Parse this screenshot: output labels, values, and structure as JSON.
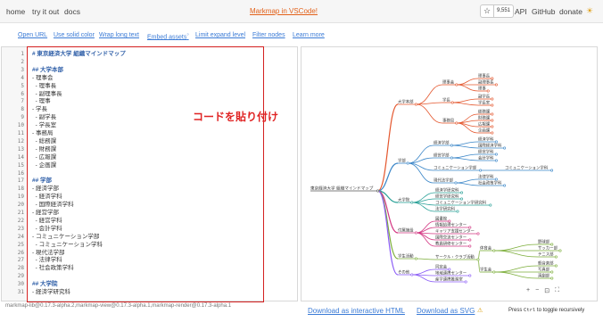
{
  "nav": {
    "home": "home",
    "try": "try it out",
    "docs": "docs",
    "vscode": "Markmap in VSCode!",
    "star_count": "9,551",
    "api": "API",
    "github": "GitHub",
    "donate": "donate"
  },
  "toolbar": {
    "open_url": "Open URL",
    "solid_color": "Use solid color",
    "wrap": "Wrap long text",
    "embed": "Embed assets",
    "embed_sup": "?",
    "limit": "Limit expand level",
    "filter": "Filter nodes",
    "learn": "Learn more"
  },
  "editor": {
    "lines": [
      {
        "n": "1",
        "t": "# 東京経済大学 組織マインドマップ",
        "k": "h"
      },
      {
        "n": "2",
        "t": "",
        "k": ""
      },
      {
        "n": "3",
        "t": "## 大学本部",
        "k": "h"
      },
      {
        "n": "4",
        "t": "- 理事会",
        "k": "li"
      },
      {
        "n": "5",
        "t": "  - 理事長",
        "k": "li"
      },
      {
        "n": "6",
        "t": "  - 副理事長",
        "k": "li"
      },
      {
        "n": "7",
        "t": "  - 理事",
        "k": "li"
      },
      {
        "n": "8",
        "t": "- 学長",
        "k": "li"
      },
      {
        "n": "9",
        "t": "  - 副学長",
        "k": "li"
      },
      {
        "n": "10",
        "t": "  - 学長室",
        "k": "li"
      },
      {
        "n": "11",
        "t": "- 事務局",
        "k": "li"
      },
      {
        "n": "12",
        "t": "  - 総務課",
        "k": "li"
      },
      {
        "n": "13",
        "t": "  - 財務課",
        "k": "li"
      },
      {
        "n": "14",
        "t": "  - 広報課",
        "k": "li"
      },
      {
        "n": "15",
        "t": "  - 企画課",
        "k": "li"
      },
      {
        "n": "16",
        "t": "",
        "k": ""
      },
      {
        "n": "17",
        "t": "## 学部",
        "k": "h"
      },
      {
        "n": "18",
        "t": "- 経済学部",
        "k": "li"
      },
      {
        "n": "19",
        "t": "  - 経済学科",
        "k": "li"
      },
      {
        "n": "20",
        "t": "  - 国際経済学科",
        "k": "li"
      },
      {
        "n": "21",
        "t": "- 経営学部",
        "k": "li"
      },
      {
        "n": "22",
        "t": "  - 経営学科",
        "k": "li"
      },
      {
        "n": "23",
        "t": "  - 会計学科",
        "k": "li"
      },
      {
        "n": "24",
        "t": "- コミュニケーション学部",
        "k": "li"
      },
      {
        "n": "25",
        "t": "  - コミュニケーション学科",
        "k": "li"
      },
      {
        "n": "26",
        "t": "- 現代法学部",
        "k": "li"
      },
      {
        "n": "27",
        "t": "  - 法律学科",
        "k": "li"
      },
      {
        "n": "28",
        "t": "  - 社会政策学科",
        "k": "li"
      },
      {
        "n": "29",
        "t": "",
        "k": ""
      },
      {
        "n": "30",
        "t": "## 大学院",
        "k": "h"
      },
      {
        "n": "31",
        "t": "- 経済学研究科",
        "k": "li"
      }
    ]
  },
  "annotation": "コードを貼り付け",
  "map": {
    "root": "東京経済大学 組織マインドマップ",
    "b1": "大学本部",
    "b2": "学部",
    "b3": "大学院",
    "b4": "付属施設",
    "b5": "学生活動",
    "b6": "その他",
    "rijikai": "理事会",
    "rijicho": "理事長",
    "fukurijicho": "副理事長",
    "riji": "理事",
    "gakucho": "学長",
    "fukugakucho": "副学長",
    "gakuchoshitsu": "学長室",
    "jimukyoku": "事務局",
    "somu": "総務課",
    "zaimu": "財務課",
    "koho": "広報課",
    "kikaku": "企画課",
    "keizaigakubu": "経済学部",
    "keizai": "経済学科",
    "kokusai": "国際経済学科",
    "keieigakubu": "経営学部",
    "keiei": "経営学科",
    "kaikei": "会計学科",
    "commu_bu": "コミュニケーション学部",
    "commu": "コミュニケーション学科",
    "gendaiho": "現代法学部",
    "horitsu": "法律学科",
    "shakai": "社会政策学科",
    "gs1": "経済学研究科",
    "gs2": "経営学研究科",
    "gs3": "コミュニケーション学研究科",
    "gs4": "法学研究科",
    "f1": "図書館",
    "f2": "情報処理センター",
    "f3": "キャリア支援センター",
    "f4": "国際交流センター",
    "f5": "教員研修センター",
    "s1": "体育会",
    "s2": "サークル・クラブ活動",
    "s3": "学生会",
    "sp1": "野球部",
    "sp2": "サッカー部",
    "sp3": "テニス部",
    "c1": "軽音楽部",
    "c2": "写真部",
    "c3": "演劇部",
    "o1": "同窓会",
    "o2": "地域連携センター",
    "o3": "産学連携推進室"
  },
  "footer": {
    "versions": "markmap-lib@0.17.3-alpha.2,markmap-view@0.17.3-alpha.1,markmap-render@0.17.3-alpha.1",
    "dl_html": "Download as interactive HTML",
    "dl_svg": "Download as SVG",
    "hint_pre": "Press ",
    "hint_key": "Ctrl",
    "hint_post": " to toggle recursively"
  },
  "colors": {
    "orange": "#e2611a",
    "link": "#3b7bd6",
    "annotation_red": "#d42020",
    "branch1": "#e4572e",
    "branch2": "#3a86c8",
    "branch3": "#2aa198",
    "branch4": "#d33682",
    "branch5": "#7cae3a",
    "branch6": "#8b5cf6"
  },
  "icons": [
    "star-icon",
    "theme-icon",
    "warning-icon",
    "zoom-in-icon",
    "zoom-out-icon",
    "fit-icon",
    "fullscreen-icon"
  ]
}
